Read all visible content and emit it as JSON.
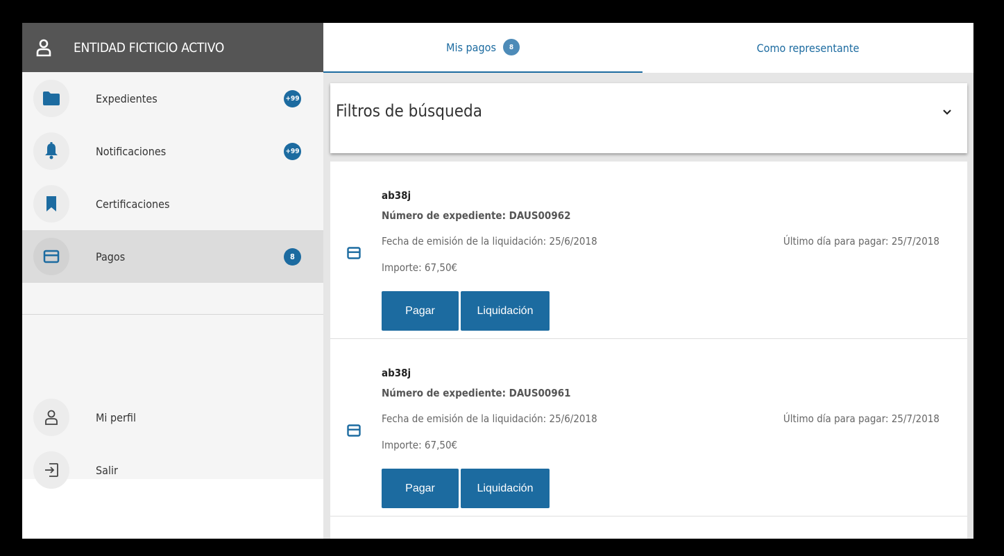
{
  "sidebar": {
    "entity_name": "ENTIDAD FICTICIO ACTIVO",
    "items": [
      {
        "label": "Expedientes",
        "badge": "+99",
        "icon": "folder-icon"
      },
      {
        "label": "Notificaciones",
        "badge": "+99",
        "icon": "bell-icon"
      },
      {
        "label": "Certificaciones",
        "badge": "",
        "icon": "bookmark-icon"
      },
      {
        "label": "Pagos",
        "badge": "8",
        "icon": "credit-card-icon"
      }
    ],
    "bottom_items": [
      {
        "label": "Mi perfil",
        "icon": "user-icon"
      },
      {
        "label": "Salir",
        "icon": "logout-icon"
      }
    ]
  },
  "tabs": [
    {
      "label": "Mis pagos",
      "badge": "8"
    },
    {
      "label": "Como representante"
    }
  ],
  "filters": {
    "title": "Filtros de búsqueda"
  },
  "payments": [
    {
      "code": "ab38j",
      "expediente": "Número de expediente: DAUS00962",
      "fecha": "Fecha de emisión de la liquidación: 25/6/2018",
      "ultimo": "Último día para pagar: 25/7/2018",
      "importe": "Importe: 67,50€",
      "pay_label": "Pagar",
      "liq_label": "Liquidación"
    },
    {
      "code": "ab38j",
      "expediente": "Número de expediente: DAUS00961",
      "fecha": "Fecha de emisión de la liquidación: 25/6/2018",
      "ultimo": "Último día para pagar: 25/7/2018",
      "importe": "Importe: 67,50€",
      "pay_label": "Pagar",
      "liq_label": "Liquidación"
    }
  ],
  "colors": {
    "accent": "#1c6ba0",
    "header_bg": "#555555",
    "active_item_bg": "#dcdcdc"
  }
}
